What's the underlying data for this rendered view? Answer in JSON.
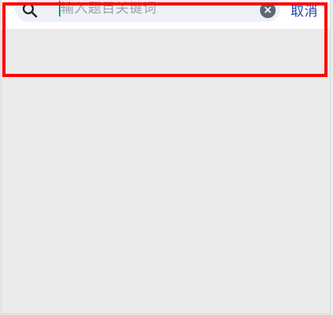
{
  "search": {
    "placeholder": "输入题目关键词",
    "clear_icon_glyph": "×",
    "cancel_label": "取消"
  },
  "icons": {
    "search": "search-icon",
    "clear": "close-circle-icon"
  },
  "colors": {
    "accent": "#1f4aa8",
    "caret": "#1f9a61",
    "highlight": "#ff0000"
  }
}
